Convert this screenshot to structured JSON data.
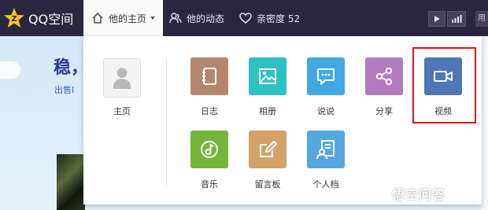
{
  "app": {
    "logo_text": "QQ空间"
  },
  "nav": {
    "home_label": "他的主页",
    "feed_label": "他的动态",
    "intimacy_label": "亲密度 52",
    "user_label": "用"
  },
  "background": {
    "title": "稳，",
    "subtitle": "出售I"
  },
  "menu": {
    "home": {
      "label": "主页",
      "icon": "user-avatar-icon"
    },
    "items": [
      {
        "label": "日志",
        "icon": "notebook-icon",
        "color": "#b4876b"
      },
      {
        "label": "相册",
        "icon": "picture-icon",
        "color": "#2ec1c4"
      },
      {
        "label": "说说",
        "icon": "speech-bubble-icon",
        "color": "#42a7e2"
      },
      {
        "label": "分享",
        "icon": "share-icon",
        "color": "#b27ac0"
      },
      {
        "label": "视频",
        "icon": "video-camera-icon",
        "color": "#4f76b6"
      },
      {
        "label": "音乐",
        "icon": "music-icon",
        "color": "#73b63a"
      },
      {
        "label": "留言板",
        "icon": "edit-board-icon",
        "color": "#d4a169"
      },
      {
        "label": "个人档",
        "icon": "profile-card-icon",
        "color": "#55a8dd"
      }
    ]
  },
  "watermark": {
    "text": "悟空问答"
  }
}
